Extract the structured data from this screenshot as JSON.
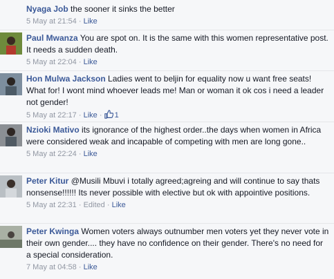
{
  "comments": [
    {
      "author": "Nyaga Job",
      "text": "the sooner it sinks the better",
      "time": "5 May at 21:54",
      "like_label": "Like"
    },
    {
      "author": "Paul Mwanza",
      "text": "You are spot on. It is the same with this women representative post. It needs a sudden death.",
      "time": "5 May at 22:04",
      "like_label": "Like"
    },
    {
      "author": "Hon Mulwa Jackson",
      "text": "Ladies went to beljin for equality now u want free seats! What for! I wont mind whoever leads me! Man or woman it ok cos i need a leader not gender!",
      "time": "5 May at 22:17",
      "like_label": "Like",
      "like_count": "1",
      "like_icon": "thumbs-up-icon"
    },
    {
      "author": "Nzioki Mativo",
      "text": "its ignorance of the highest order..the days when women in Africa were considered weak and incapable of competing with men are long gone..",
      "time": "5 May at 22:24",
      "like_label": "Like"
    },
    {
      "author": "Peter Kitur",
      "text": "@Musili Mbuvi i totally agreed;agreing and will continue to say thats nonsense!!!!!! Its never possible with elective but ok with appointive positions.",
      "time": "5 May at 22:31",
      "edited_label": "Edited",
      "like_label": "Like"
    },
    {
      "author": "Peter Kwinga",
      "text": "Women voters always outnumber men voters yet they never vote in their own gender.... they have no confidence on their gender. There's no need for a special consideration.",
      "time": "7 May at 04:58",
      "like_label": "Like"
    }
  ],
  "colors": {
    "author_link": "#3b5998",
    "meta_text": "#9197a3",
    "body_text": "#141823",
    "background": "#f6f7f9"
  }
}
